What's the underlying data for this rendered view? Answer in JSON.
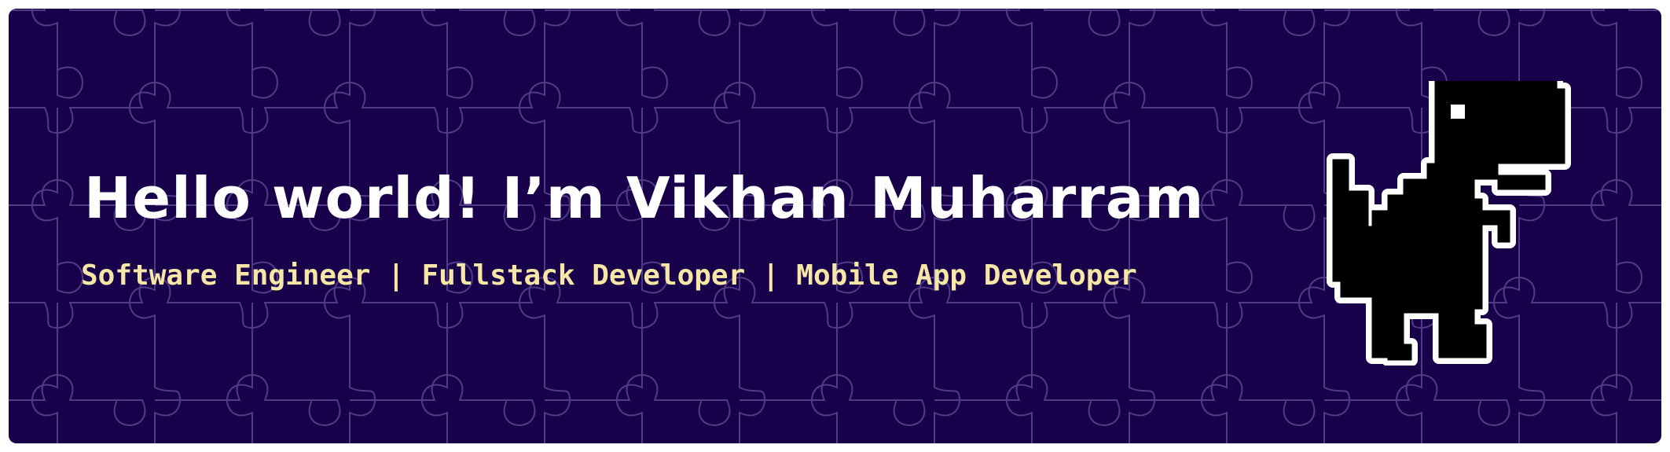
{
  "banner": {
    "headline": "Hello world! I’m Vikhan Muharram",
    "tagline": "Software Engineer | Fullstack Developer | Mobile App Developer",
    "dino_icon": "pixel-t-rex-dinosaur",
    "background_pattern": "jigsaw-puzzle",
    "colors": {
      "background": "#19004a",
      "puzzle_lines": "#4e3c86",
      "headline": "#ffffff",
      "tagline": "#f7e7a6",
      "dino": "#000000",
      "dino_outline": "#ffffff"
    }
  }
}
